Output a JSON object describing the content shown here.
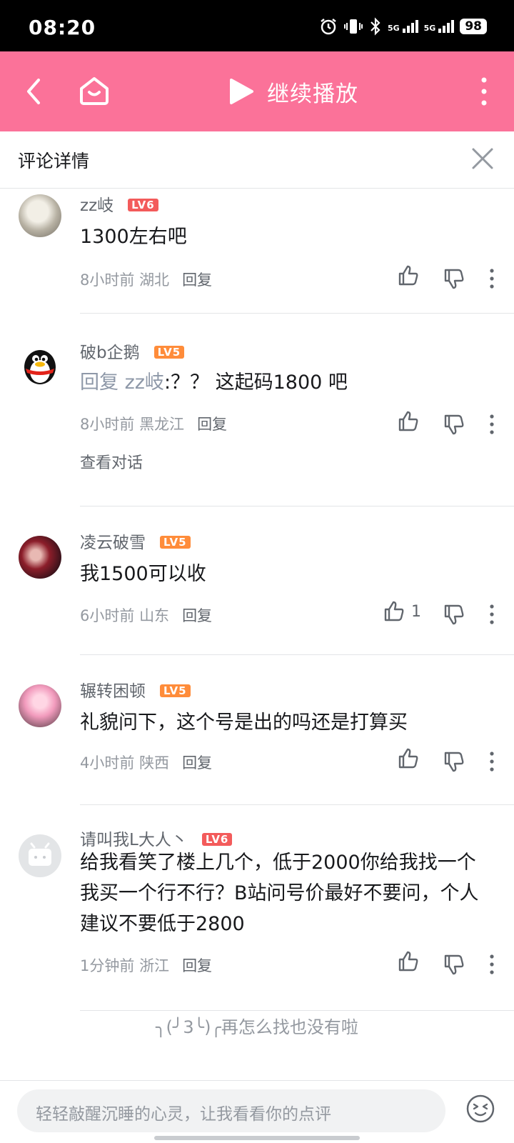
{
  "status_bar": {
    "time": "08:20",
    "battery": "98",
    "network_1": "5G",
    "network_2": "5G"
  },
  "nav": {
    "continue_play": "继续播放"
  },
  "panel": {
    "title": "评论详情"
  },
  "comments": [
    {
      "user": "zz岐",
      "level": "LV6",
      "text": "1300左右吧",
      "time": "8小时前",
      "region": "湖北",
      "reply": "回复",
      "likes": ""
    },
    {
      "user": "破b企鹅",
      "level": "LV5",
      "reply_to": "回复 zz岐",
      "text": ":？？ 这起码1800 吧",
      "time": "8小时前",
      "region": "黑龙江",
      "reply": "回复",
      "likes": "",
      "view_conversation": "查看对话"
    },
    {
      "user": "凌云破雪",
      "level": "LV5",
      "text": "我1500可以收",
      "time": "6小时前",
      "region": "山东",
      "reply": "回复",
      "likes": "1"
    },
    {
      "user": "辗转困顿",
      "level": "LV5",
      "text": "礼貌问下，这个号是出的吗还是打算买",
      "time": "4小时前",
      "region": "陕西",
      "reply": "回复",
      "likes": ""
    },
    {
      "user": "请叫我L大人丶",
      "level": "LV6",
      "text": "给我看笑了楼上几个，低于2000你给我找一个我买一个行不行？B站问号价最好不要问，个人建议不要低于2800",
      "time": "1分钟前",
      "region": "浙江",
      "reply": "回复",
      "likes": ""
    }
  ],
  "end_note": "╮(╯3╰)╭再怎么找也没有啦",
  "comment_input": {
    "placeholder": "轻轻敲醒沉睡的心灵，让我看看你的点评"
  },
  "colors": {
    "brand_pink": "#fb7299",
    "lv6": "#f35b5b",
    "lv5": "#ff8c3a"
  },
  "icons": [
    "back-icon",
    "home-icon",
    "play-icon",
    "more-icon",
    "close-icon",
    "like-icon",
    "dislike-icon",
    "emoji-icon",
    "alarm-icon",
    "vibrate-icon",
    "bluetooth-icon",
    "signal-icon"
  ]
}
